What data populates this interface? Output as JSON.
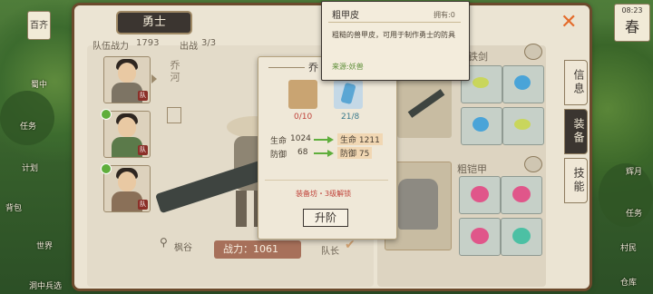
{
  "left_menu": {
    "top_item": "百齐",
    "items": [
      "蜀中",
      "任务",
      "计划",
      "世界",
      "背包",
      "洞中兵选"
    ]
  },
  "right_menu": {
    "items": [
      "辉月",
      "任务",
      "村民",
      "仓库"
    ],
    "time": "08:23",
    "season": "春"
  },
  "team": {
    "title": "勇士",
    "power_label": "队伍战力",
    "power_value": "1793",
    "deploy_label": "出战",
    "deploy_value": "3/3",
    "leader_badge": "队",
    "leader_label": "队长",
    "location": "枫谷"
  },
  "hero": {
    "name": "乔河",
    "power_label": "战力：",
    "power_value": "1061"
  },
  "equipment": {
    "weapon_label": "铁剑",
    "armor_label": "粗铠甲"
  },
  "tabs": [
    "信息",
    "装备",
    "技能"
  ],
  "popup": {
    "title": "乔",
    "materials": [
      {
        "count": "0/10",
        "icon": "leather-bundle"
      },
      {
        "count": "21/8",
        "icon": "blue-crystal"
      }
    ],
    "stats": [
      {
        "name": "生命",
        "before": "1024",
        "after": "1211"
      },
      {
        "name": "防御",
        "before": "68",
        "after": "75"
      }
    ],
    "note": "装备坊・3级解锁",
    "upgrade_label": "升阶"
  },
  "tooltip": {
    "title": "粗甲皮",
    "owned": "拥有:0",
    "desc": "粗糙的兽甲皮，可用于制作勇士的防具",
    "source": "来源:妖兽"
  },
  "colors": {
    "accent": "#e46b2a",
    "dark": "#3b3530",
    "paper": "#ebe4d3",
    "stat_highlight": "#f1d7b3",
    "material_count_ok": "#3b7a8c",
    "material_count_bad": "#c0443b"
  }
}
